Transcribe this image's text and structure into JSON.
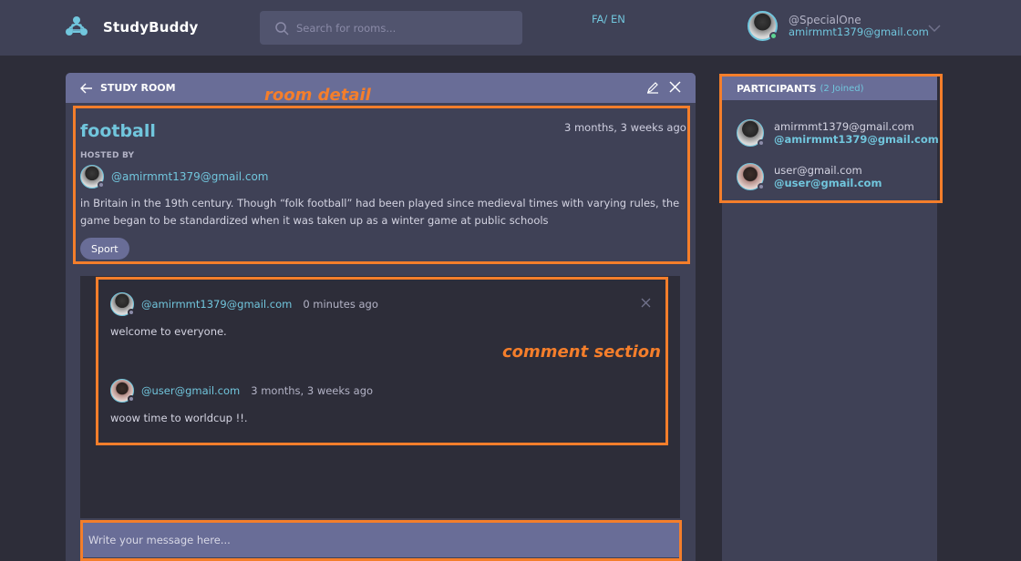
{
  "app": {
    "name": "StudyBuddy",
    "logo_icon": "study-buddy-logo-icon"
  },
  "header": {
    "search_placeholder": "Search for rooms...",
    "lang_fa": "FA/",
    "lang_en": "EN",
    "user_handle": "@SpecialOne",
    "user_email": "amirmmt1379@gmail.com"
  },
  "room": {
    "header_title": "STUDY ROOM",
    "name": "football",
    "time": "3 months, 3 weeks ago",
    "hosted_by_label": "HOSTED BY",
    "host_handle": "@amirmmt1379@gmail.com",
    "description": "in Britain in the 19th century. Though “folk football” had been played since medieval times with varying rules, the game began to be standardized when it was taken up as a winter game at public schools",
    "tag": "Sport"
  },
  "comments": [
    {
      "handle": "@amirmmt1379@gmail.com",
      "time": "0 minutes ago",
      "body": "welcome to everyone."
    },
    {
      "handle": "@user@gmail.com",
      "time": "3 months, 3 weeks ago",
      "body": "woow time to worldcup !!."
    }
  ],
  "message_input": {
    "placeholder": "Write your message here..."
  },
  "participants": {
    "title": "PARTICIPANTS",
    "count": "(2 Joined)",
    "items": [
      {
        "name": "amirmmt1379@gmail.com",
        "handle": "@amirmmt1379@gmail.com"
      },
      {
        "name": "user@gmail.com",
        "handle": "@user@gmail.com"
      }
    ]
  },
  "annotations": {
    "room_detail": "room detail",
    "comment_section": "comment section"
  },
  "colors": {
    "background": "#2d2d39",
    "surface": "#3f4156",
    "accent": "#696d97",
    "link": "#71c6dd",
    "annotation": "#f47e2b",
    "online": "#5dd693",
    "offline": "#8b8ba8"
  }
}
